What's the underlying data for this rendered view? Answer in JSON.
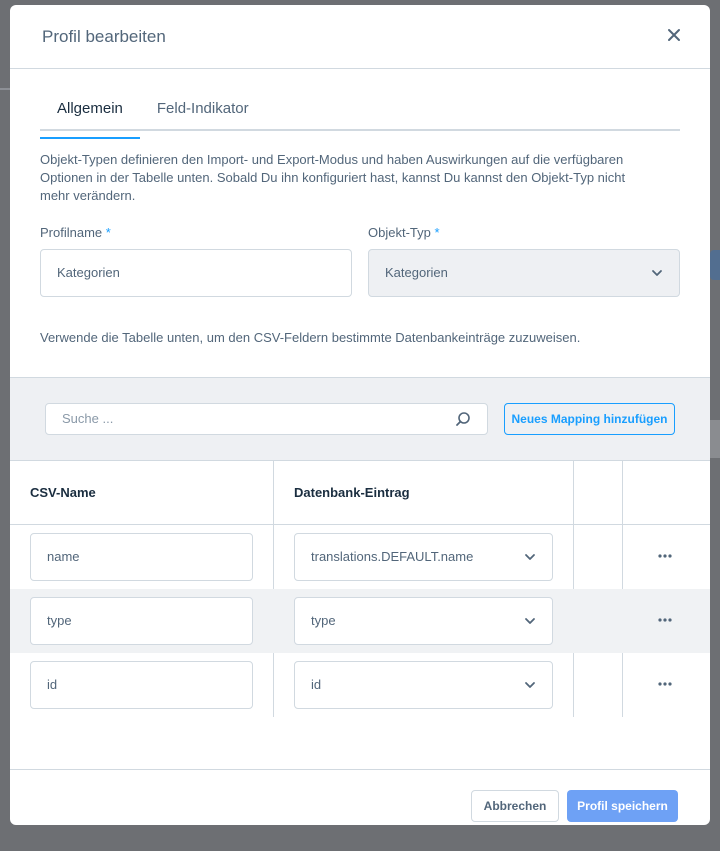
{
  "modal": {
    "title": "Profil bearbeiten"
  },
  "tabs": [
    {
      "label": "Allgemein",
      "active": true
    },
    {
      "label": "Feld-Indikator",
      "active": false
    }
  ],
  "description": "Objekt-Typen definieren den Import- und Export-Modus und haben Auswirkungen auf die verfügbaren Optionen in der Tabelle unten. Sobald Du ihn konfiguriert hast, kannst Du kannst den Objekt-Typ nicht mehr verändern.",
  "form": {
    "profile_name_label": "Profilname",
    "profile_name_value": "Kategorien",
    "object_type_label": "Objekt-Typ",
    "object_type_value": "Kategorien",
    "required_mark": "*"
  },
  "hint": "Verwende die Tabelle unten, um den CSV-Feldern bestimmte Datenbankeinträge zuzuweisen.",
  "toolbar": {
    "search_placeholder": "Suche ...",
    "add_mapping_label": "Neues Mapping hinzufügen"
  },
  "table": {
    "columns": [
      "CSV-Name",
      "Datenbank-Eintrag"
    ],
    "rows": [
      {
        "csv_name": "name",
        "db_entry": "translations.DEFAULT.name"
      },
      {
        "csv_name": "type",
        "db_entry": "type"
      },
      {
        "csv_name": "id",
        "db_entry": "id"
      }
    ]
  },
  "footer": {
    "cancel_label": "Abbrechen",
    "save_label": "Profil speichern"
  },
  "colors": {
    "accent": "#189eff",
    "primary_button": "#6ea1f5",
    "text": "#52667a",
    "border": "#d1d9e0"
  }
}
